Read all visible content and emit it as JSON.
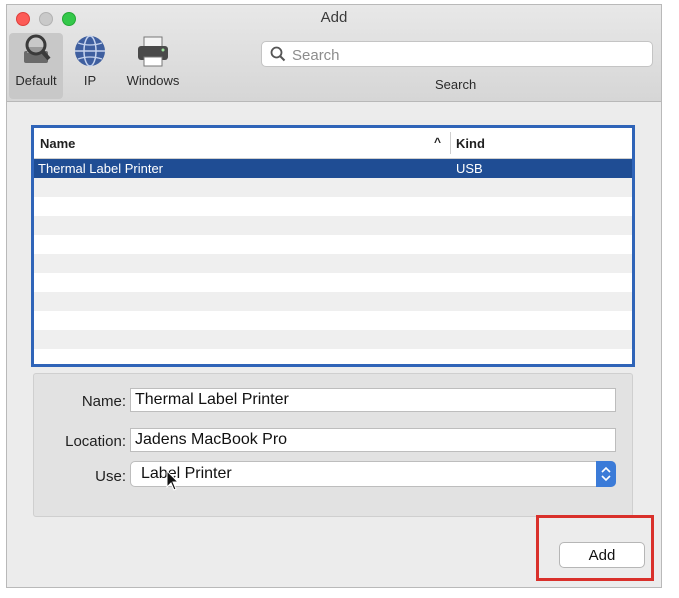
{
  "window": {
    "title": "Add"
  },
  "toolbar": {
    "items": [
      {
        "label": "Default",
        "icon": "default-printer-icon",
        "selected": true
      },
      {
        "label": "IP",
        "icon": "globe-icon",
        "selected": false
      },
      {
        "label": "Windows",
        "icon": "printer-icon",
        "selected": false
      }
    ],
    "search": {
      "placeholder": "Search",
      "value": "",
      "label": "Search"
    }
  },
  "printer_list": {
    "columns": {
      "name": "Name",
      "kind": "Kind"
    },
    "rows": [
      {
        "name": "Thermal Label Printer",
        "kind": "USB",
        "selected": true
      }
    ],
    "accent_color": "#2f64b8",
    "selection_color": "#1f4d94"
  },
  "details": {
    "name_label": "Name:",
    "name_value": "Thermal Label Printer",
    "location_label": "Location:",
    "location_value": "Jadens MacBook Pro",
    "use_label": "Use:",
    "use_value": "Label Printer"
  },
  "buttons": {
    "add_label": "Add"
  },
  "highlight_color": "#d9302b"
}
